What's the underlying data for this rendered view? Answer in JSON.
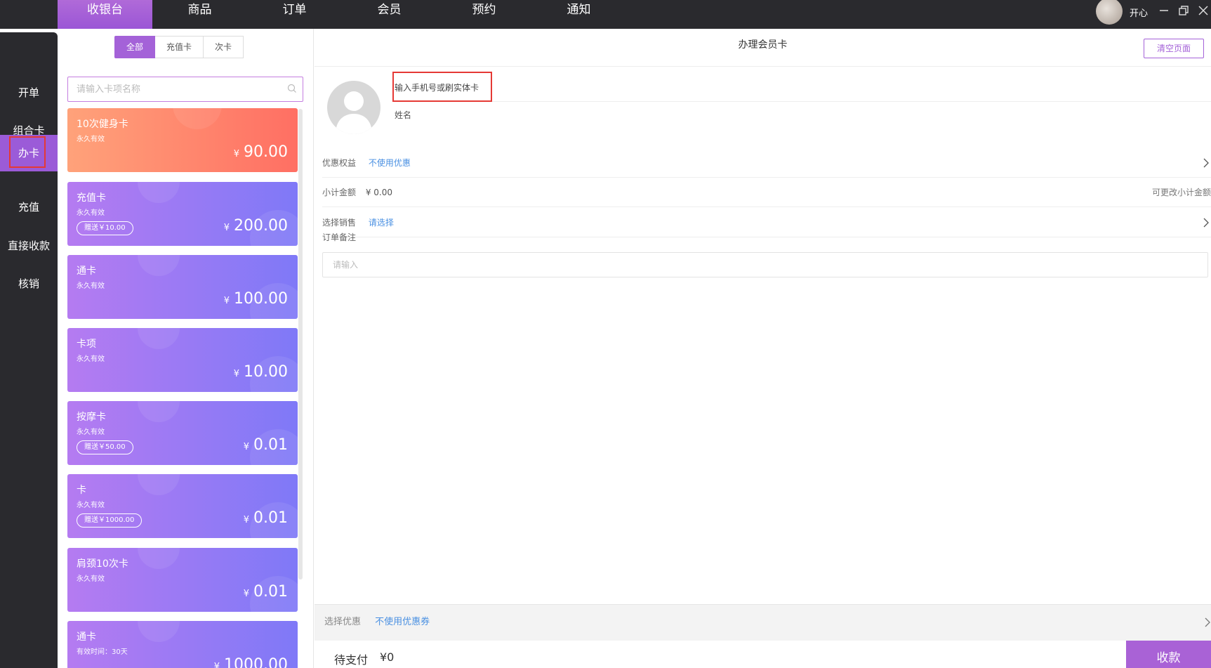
{
  "topnav": {
    "tabs": [
      {
        "label": "收银台",
        "active": true
      },
      {
        "label": "商品"
      },
      {
        "label": "订单"
      },
      {
        "label": "会员"
      },
      {
        "label": "预约"
      },
      {
        "label": "通知"
      }
    ],
    "user_name": "开心",
    "window_controls": [
      "minimize-icon",
      "restore-icon",
      "close-icon"
    ]
  },
  "sidebar": {
    "items": [
      {
        "label": "开单"
      },
      {
        "label": "组合卡"
      },
      {
        "label": "办卡",
        "active": true
      },
      {
        "label": "充值"
      },
      {
        "label": "直接收款"
      },
      {
        "label": "核销"
      }
    ]
  },
  "card_panel": {
    "filters": [
      {
        "label": "全部",
        "active": true
      },
      {
        "label": "充值卡"
      },
      {
        "label": "次卡"
      }
    ],
    "search_placeholder": "请输入卡项名称",
    "currency": "¥",
    "cards": [
      {
        "name": "10次健身卡",
        "validity": "永久有效",
        "price": "90.00",
        "style": "orange"
      },
      {
        "name": "充值卡",
        "validity": "永久有效",
        "gift": "赠送￥10.00",
        "price": "200.00",
        "style": "purple"
      },
      {
        "name": "通卡",
        "validity": "永久有效",
        "price": "100.00",
        "style": "purple"
      },
      {
        "name": "卡项",
        "validity": "永久有效",
        "price": "10.00",
        "style": "purple"
      },
      {
        "name": "按摩卡",
        "validity": "永久有效",
        "gift": "赠送￥50.00",
        "price": "0.01",
        "style": "purple"
      },
      {
        "name": "卡",
        "validity": "永久有效",
        "gift": "赠送￥1000.00",
        "price": "0.01",
        "style": "purple"
      },
      {
        "name": "肩颈10次卡",
        "validity": "永久有效",
        "price": "0.01",
        "style": "purple"
      },
      {
        "name": "通卡",
        "validity": "有效时间：30天",
        "price": "1000.00",
        "style": "purple"
      }
    ]
  },
  "main": {
    "title": "办理会员卡",
    "clear_button": "清空页面",
    "phone_placeholder": "输入手机号或刷实体卡",
    "name_label": "姓名",
    "benefit": {
      "label": "优惠权益",
      "value": "不使用优惠"
    },
    "subtotal": {
      "label": "小计金额",
      "value": "¥ 0.00",
      "hint": "可更改小计金额"
    },
    "sales": {
      "label": "选择销售",
      "value": "请选择"
    },
    "note": {
      "label": "订单备注",
      "placeholder": "请输入"
    },
    "discount": {
      "label": "选择优惠",
      "value": "不使用优惠券"
    },
    "pay": {
      "label": "待支付",
      "amount": "¥0"
    },
    "collect_button": "收款"
  },
  "colors": {
    "accent": "#a462d8",
    "topbar": "#2a2a2e",
    "link": "#4a90e2",
    "highlight": "#e53935"
  }
}
